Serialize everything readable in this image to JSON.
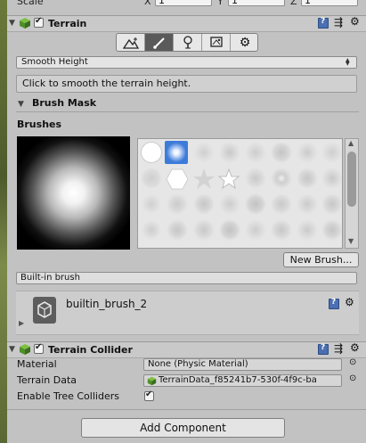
{
  "transform": {
    "scale_label": "Scale",
    "x_label": "X",
    "x_value": "1",
    "y_label": "Y",
    "y_value": "1",
    "z_label": "Z",
    "z_value": "1"
  },
  "terrain": {
    "title": "Terrain",
    "enabled": true,
    "tools": [
      {
        "icon": "raise-lower-icon",
        "glyph": "⛰"
      },
      {
        "icon": "paint-brush-icon",
        "glyph": "🖌"
      },
      {
        "icon": "tree-icon",
        "glyph": "♣"
      },
      {
        "icon": "details-icon",
        "glyph": "❀"
      },
      {
        "icon": "settings-gear-icon",
        "glyph": "⚙"
      }
    ],
    "active_tool": 1,
    "mode_selected": "Smooth Height",
    "help_text": "Click to smooth the terrain height.",
    "brush_mask_label": "Brush Mask",
    "brushes_label": "Brushes",
    "new_brush_label": "New Brush...",
    "built_in_brush_label": "Built-in brush",
    "brush_asset_name": "builtin_brush_2"
  },
  "collider": {
    "title": "Terrain Collider",
    "enabled": true,
    "material_label": "Material",
    "material_value": "None (Physic Material)",
    "terrain_data_label": "Terrain Data",
    "terrain_data_value": "TerrainData_f85241b7-530f-4f9c-ba",
    "tree_colliders_label": "Enable Tree Colliders",
    "tree_colliders_enabled": true
  },
  "add_component_label": "Add Component",
  "colors": {
    "panel_bg": "#c2c2c2",
    "header_bg": "#c9c9c9",
    "active_tool_bg": "#5a5a5a",
    "selected_brush": "#3d7bd9"
  }
}
